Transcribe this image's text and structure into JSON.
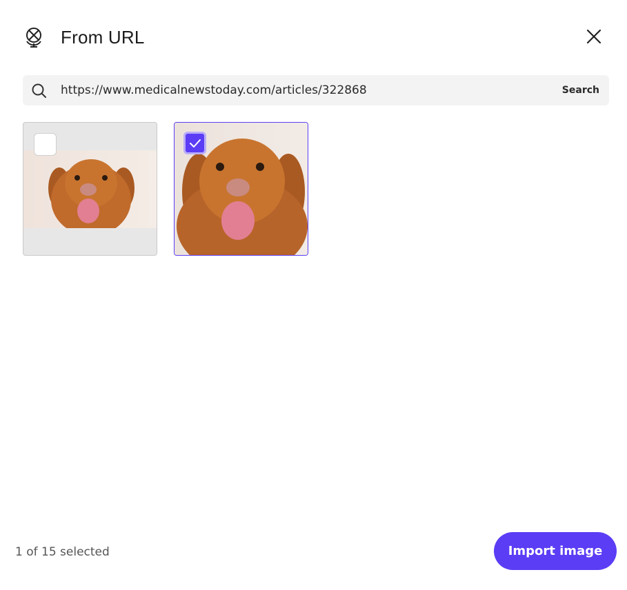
{
  "dialog": {
    "title": "From URL",
    "header_icon": "no-link-globe-icon",
    "close_icon": "close-icon"
  },
  "search": {
    "value": "https://www.medicalnewstoday.com/articles/322868",
    "button_label": "Search",
    "icon": "search-icon"
  },
  "results": [
    {
      "selected": false,
      "image": "dog-photo"
    },
    {
      "selected": true,
      "image": "dog-photo"
    }
  ],
  "footer": {
    "selection_count": "1 of 15 selected",
    "import_label": "Import image"
  },
  "colors": {
    "accent": "#5b3df5",
    "tile_background": "#e7e7e7",
    "search_background": "#f3f3f3"
  }
}
